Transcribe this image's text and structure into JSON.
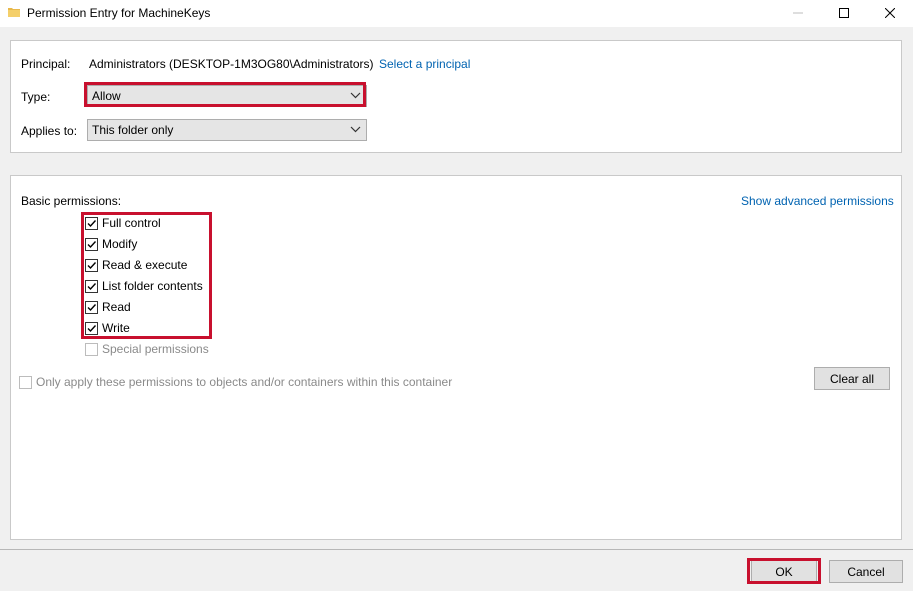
{
  "window": {
    "title": "Permission Entry for MachineKeys",
    "icon": "folder-icon"
  },
  "principal": {
    "label": "Principal:",
    "value": "Administrators (DESKTOP-1M3OG80\\Administrators)",
    "select_link": "Select a principal"
  },
  "type": {
    "label": "Type:",
    "value": "Allow"
  },
  "applies_to": {
    "label": "Applies to:",
    "value": "This folder only"
  },
  "basic": {
    "label": "Basic permissions:",
    "advanced_link": "Show advanced permissions",
    "items": [
      {
        "label": "Full control",
        "checked": true
      },
      {
        "label": "Modify",
        "checked": true
      },
      {
        "label": "Read & execute",
        "checked": true
      },
      {
        "label": "List folder contents",
        "checked": true
      },
      {
        "label": "Read",
        "checked": true
      },
      {
        "label": "Write",
        "checked": true
      },
      {
        "label": "Special permissions",
        "checked": false
      }
    ]
  },
  "only_apply": {
    "label": "Only apply these permissions to objects and/or containers within this container",
    "checked": false
  },
  "buttons": {
    "clear_all": "Clear all",
    "ok": "OK",
    "cancel": "Cancel"
  },
  "colors": {
    "highlight": "#c8102e",
    "link": "#0063b1"
  }
}
